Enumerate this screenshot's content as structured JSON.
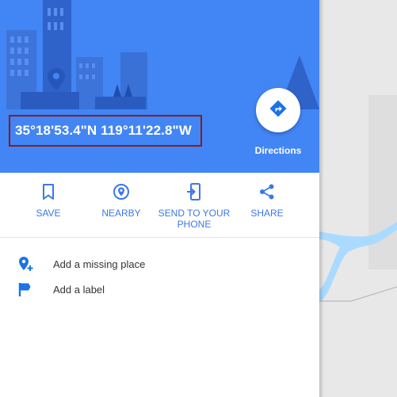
{
  "place": {
    "coordinates": "35°18'53.4\"N 119°11'22.8\"W"
  },
  "directions": {
    "label": "Directions",
    "icon": "directions-icon"
  },
  "actions": [
    {
      "label": "SAVE",
      "icon": "bookmark-icon"
    },
    {
      "label": "NEARBY",
      "icon": "nearby-icon"
    },
    {
      "label": "SEND TO YOUR PHONE",
      "icon": "send-to-phone-icon"
    },
    {
      "label": "SHARE",
      "icon": "share-icon"
    }
  ],
  "list": [
    {
      "label": "Add a missing place",
      "icon": "add-place-icon"
    },
    {
      "label": "Add a label",
      "icon": "label-flag-icon"
    }
  ],
  "colors": {
    "hero_blue": "#4285f4",
    "accent_blue": "#3b78e7",
    "highlight_border": "#8b1c1c",
    "map_water": "#aadaff"
  }
}
